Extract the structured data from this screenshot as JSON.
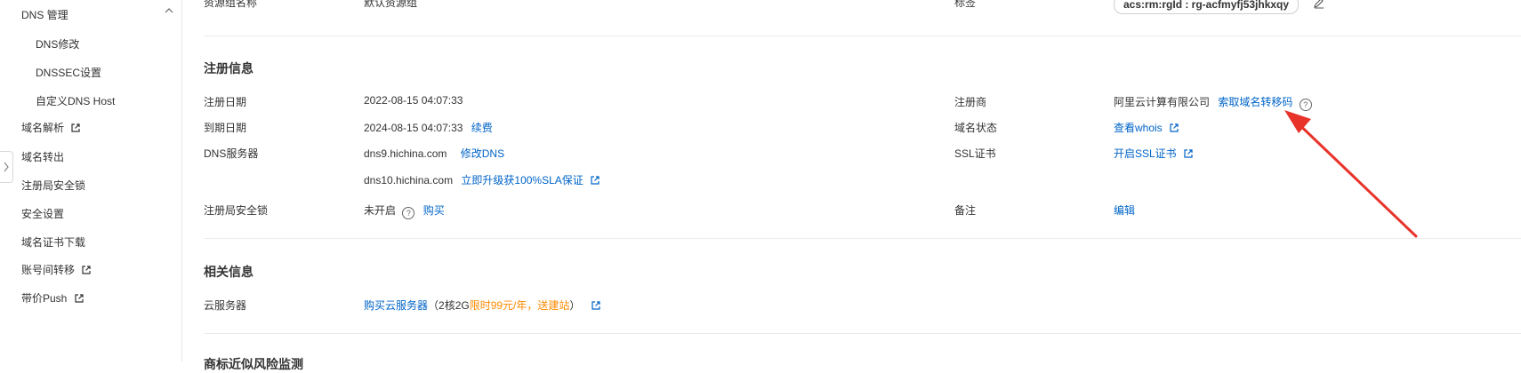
{
  "sidebar": {
    "dns_group": "DNS 管理",
    "items": [
      {
        "label": "DNS修改"
      },
      {
        "label": "DNSSEC设置"
      },
      {
        "label": "自定义DNS Host"
      },
      {
        "label": "域名解析"
      },
      {
        "label": "域名转出"
      },
      {
        "label": "注册局安全锁"
      },
      {
        "label": "安全设置"
      },
      {
        "label": "域名证书下载"
      },
      {
        "label": "账号间转移"
      },
      {
        "label": "带价Push"
      }
    ]
  },
  "top_row": {
    "resource_group_label": "资源组名称",
    "resource_group_value": "默认资源组",
    "tag_label": "标签",
    "tag_value": "acs:rm:rgId : rg-acfmyfj53jhkxqy"
  },
  "registration": {
    "title": "注册信息",
    "reg_date_label": "注册日期",
    "reg_date_value": "2022-08-15 04:07:33",
    "registrar_label": "注册商",
    "registrar_value": "阿里云计算有限公司",
    "registrar_link": "索取域名转移码",
    "expire_label": "到期日期",
    "expire_value": "2024-08-15 04:07:33",
    "renew_link": "续费",
    "status_label": "域名状态",
    "whois_link": "查看whois",
    "dns_label": "DNS服务器",
    "dns1": "dns9.hichina.com",
    "modify_dns_link": "修改DNS",
    "dns2": "dns10.hichina.com",
    "upgrade_link": "立即升级获100%SLA保证",
    "ssl_label": "SSL证书",
    "ssl_link": "开启SSL证书",
    "lock_label": "注册局安全锁",
    "lock_value": "未开启",
    "buy_link": "购买",
    "remark_label": "备注",
    "edit_link": "编辑"
  },
  "related": {
    "title": "相关信息",
    "server_label": "云服务器",
    "server_link": "购买云服务器",
    "promo_prefix": "（2核2G",
    "promo_highlight": "限时99元/年，送建站",
    "promo_suffix": "）"
  },
  "next_section_partial": "商标近似风险监测",
  "colors": {
    "link": "#0064c8",
    "promo": "#ff8a00",
    "arrow": "#e8332a"
  }
}
